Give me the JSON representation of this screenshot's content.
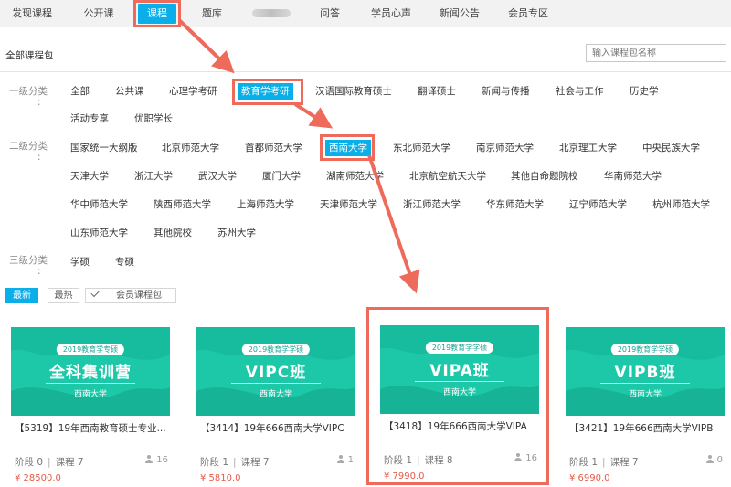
{
  "nav": [
    {
      "label": "发现课程",
      "active": false
    },
    {
      "label": "公开课",
      "active": false
    },
    {
      "label": "课程包",
      "active": true
    },
    {
      "label": "题库",
      "active": false
    },
    {
      "label": "",
      "active": false
    },
    {
      "label": "问答",
      "active": false
    },
    {
      "label": "学员心声",
      "active": false
    },
    {
      "label": "新闻公告",
      "active": false
    },
    {
      "label": "会员专区",
      "active": false
    }
  ],
  "section_title": "全部课程包",
  "search": {
    "placeholder": "输入课程包名称"
  },
  "level1": {
    "label": "一级分类",
    "colon": ":",
    "items": [
      "全部",
      "公共课",
      "心理学考研",
      "教育学考研",
      "汉语国际教育硕士",
      "翻译硕士",
      "新闻与传播",
      "社会与工作",
      "历史学",
      "活动专享",
      "优职学长"
    ],
    "selected": "教育学考研"
  },
  "level2": {
    "label": "二级分类",
    "colon": ":",
    "items": [
      "国家统一大纲版",
      "北京师范大学",
      "首都师范大学",
      "西南大学",
      "东北师范大学",
      "南京师范大学",
      "北京理工大学",
      "中央民族大学",
      "天津大学",
      "浙江大学",
      "武汉大学",
      "厦门大学",
      "湖南师范大学",
      "北京航空航天大学",
      "其他自命题院校",
      "华南师范大学",
      "华中师范大学",
      "陕西师范大学",
      "上海师范大学",
      "天津师范大学",
      "浙江师范大学",
      "华东师范大学",
      "辽宁师范大学",
      "杭州师范大学",
      "山东师范大学",
      "其他院校",
      "苏州大学"
    ],
    "selected": "西南大学"
  },
  "level3": {
    "label": "三级分类",
    "colon": ":",
    "items": [
      "学硕",
      "专硕"
    ]
  },
  "sort": {
    "newest": "最新",
    "hottest": "最热",
    "member": "会员课程包"
  },
  "cards": [
    {
      "tag": "2019教育学专硕",
      "title": "全科集训营",
      "school": "西南大学",
      "name": "【5319】19年西南教育硕士专业...",
      "stage_label": "阶段",
      "stage": "0",
      "course_label": "课程",
      "course": "7",
      "students": "16",
      "price": "¥ 28500.0"
    },
    {
      "tag": "2019教育学学硕",
      "title": "VIPC班",
      "school": "西南大学",
      "name": "【3414】19年666西南大学VIPC",
      "stage_label": "阶段",
      "stage": "1",
      "course_label": "课程",
      "course": "7",
      "students": "1",
      "price": "¥ 5810.0"
    },
    {
      "tag": "2019教育学学硕",
      "title": "VIPA班",
      "school": "西南大学",
      "name": "【3418】19年666西南大学VIPA",
      "stage_label": "阶段",
      "stage": "1",
      "course_label": "课程",
      "course": "8",
      "students": "16",
      "price": "¥ 7990.0"
    },
    {
      "tag": "2019教育学学硕",
      "title": "VIPB班",
      "school": "西南大学",
      "name": "【3421】19年666西南大学VIPB",
      "stage_label": "阶段",
      "stage": "1",
      "course_label": "课程",
      "course": "7",
      "students": "0",
      "price": "¥ 6990.0"
    }
  ],
  "colors": {
    "accent": "#0aaee8",
    "highlight": "#ee6a5a",
    "price": "#e65a4a",
    "cover": "#1cc8a8"
  }
}
